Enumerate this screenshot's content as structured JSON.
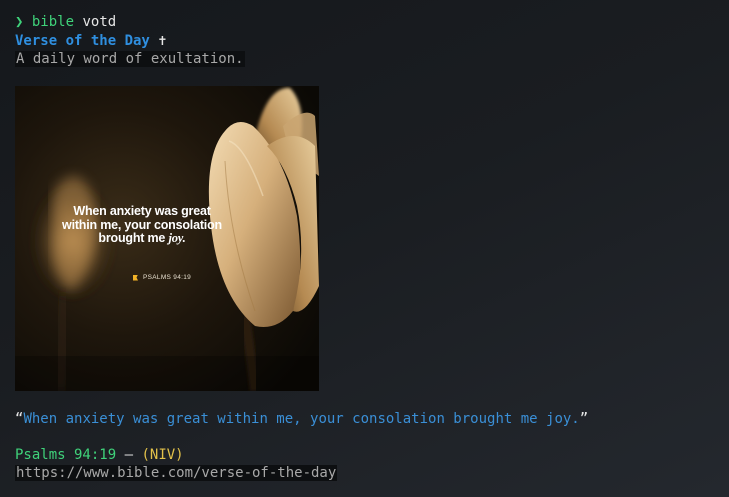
{
  "terminal": {
    "prompt_symbol": "❯",
    "command_bin": "bible",
    "command_arg": "votd"
  },
  "header": {
    "title": "Verse of the Day",
    "cross": "✝",
    "subtitle": "A daily word of exultation."
  },
  "image": {
    "verse_lines": [
      "When anxiety was great",
      "within me, your consolation",
      "brought me"
    ],
    "verse_emphasis": "joy.",
    "reference": "PSALMS 94:19",
    "icon": "bookmark-flag-icon",
    "accent_color": "#f2b227"
  },
  "verse": {
    "open_quote": "“",
    "text": "When anxiety was great within me, your consolation brought me joy.",
    "close_quote": "”"
  },
  "citation": {
    "reference": "Psalms 94:19",
    "separator": "—",
    "version": "(NIV)",
    "url": "https://www.bible.com/verse-of-the-day"
  },
  "colors": {
    "green": "#3fd27a",
    "blue": "#2f8fe0",
    "yellow": "#e2c14a"
  }
}
